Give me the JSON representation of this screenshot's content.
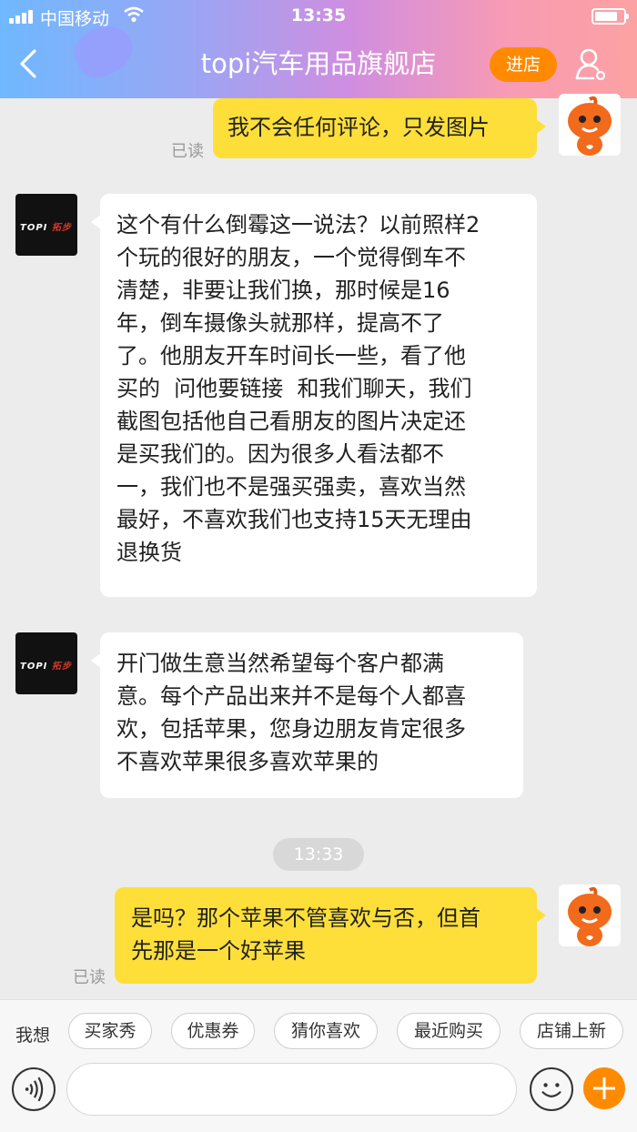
{
  "status_bar": {
    "carrier": "中国移动",
    "time": "13:35"
  },
  "header": {
    "title": "topi汽车用品旗舰店",
    "enter_store": "进店"
  },
  "messages": [
    {
      "sender": "me",
      "text": "我不会任何评论，只发图片",
      "read": "已读"
    },
    {
      "sender": "shop",
      "shop_logo": "TOPI",
      "shop_logo_cn": "拓步",
      "lines": [
        "这个有什么倒霉这一说法？以前照样2",
        "个玩的很好的朋友，一个觉得倒车不",
        "清楚，非要让我们换，那时候是16",
        "年，倒车摄像头就那样，提高不了",
        "了。他朋友开车时间长一些，看了他",
        "买的  问他要链接  和我们聊天，我们",
        "截图包括他自己看朋友的图片决定还",
        "是买我们的。因为很多人看法都不",
        "一，我们也不是强买强卖，喜欢当然",
        "最好，不喜欢我们也支持15天无理由",
        "退换货"
      ]
    },
    {
      "sender": "shop",
      "shop_logo": "TOPI",
      "shop_logo_cn": "拓步",
      "lines": [
        "开门做生意当然希望每个客户都满",
        "意。每个产品出来并不是每个人都喜",
        "欢，包括苹果，您身边朋友肯定很多",
        "不喜欢苹果很多喜欢苹果的"
      ]
    },
    {
      "sender": "me",
      "lines": [
        "是吗？那个苹果不管喜欢与否，但首",
        "先那是一个好苹果"
      ],
      "read": "已读"
    }
  ],
  "timestamp": "13:33",
  "quick_replies": {
    "label": "我想",
    "chips": [
      "买家秀",
      "优惠券",
      "猜你喜欢",
      "最近购买",
      "店铺上新"
    ]
  },
  "colors": {
    "accent": "#ff8a00",
    "my_bubble": "#fedf3a",
    "background": "#ececec"
  },
  "icons": [
    "signal-icon",
    "wifi-icon",
    "battery-icon",
    "back-icon",
    "profile-icon",
    "voice-icon",
    "emoji-icon",
    "plus-icon"
  ]
}
